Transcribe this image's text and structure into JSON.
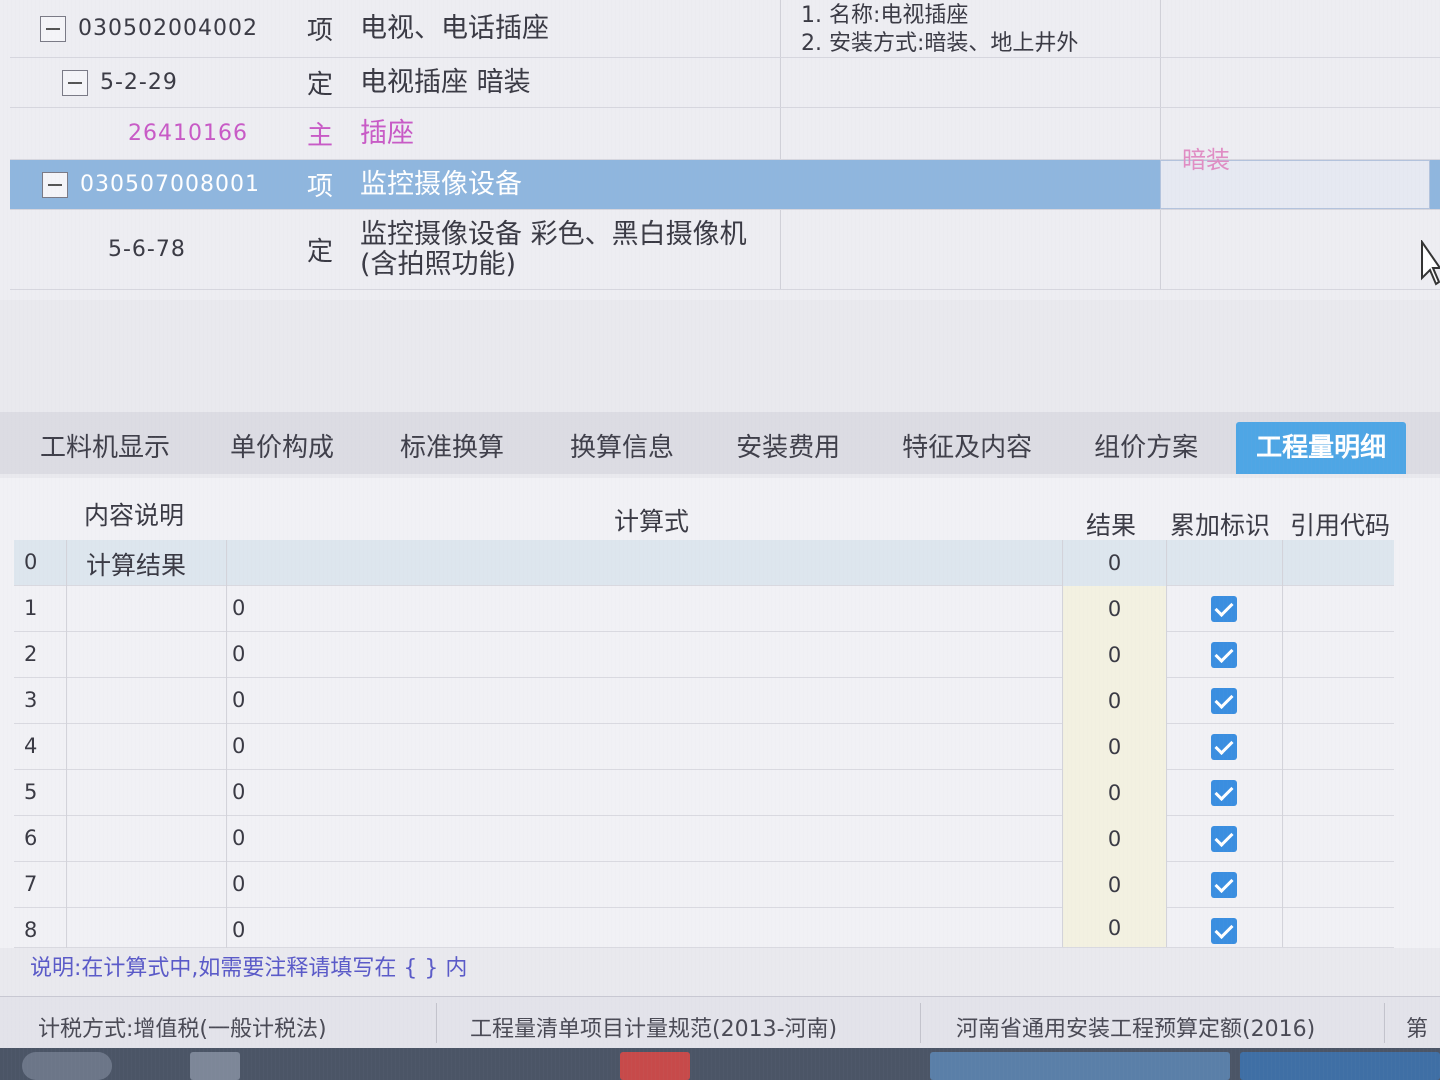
{
  "bill_rows": [
    {
      "code": "030502004002",
      "type": "项",
      "name": "电视、电话插座",
      "features": "1. 名称:电视插座\n2. 安装方式:暗装、地上井外"
    },
    {
      "code": "5-2-29",
      "type": "定",
      "name": "电视插座 暗装",
      "features": ""
    },
    {
      "code": "26410166",
      "type": "主",
      "name": "插座",
      "features": ""
    },
    {
      "code": "030507008001",
      "type": "项",
      "name": "监控摄像设备",
      "features": ""
    },
    {
      "code": "5-6-78",
      "type": "定",
      "name": "监控摄像设备 彩色、黑白摄像机(含拍照功能)",
      "features": ""
    }
  ],
  "side_tag": "暗装",
  "tabs": [
    {
      "label": "工料机显示"
    },
    {
      "label": "单价构成"
    },
    {
      "label": "标准换算"
    },
    {
      "label": "换算信息"
    },
    {
      "label": "安装费用"
    },
    {
      "label": "特征及内容"
    },
    {
      "label": "组价方案"
    },
    {
      "label": "工程量明细"
    }
  ],
  "grid": {
    "headers": {
      "desc": "内容说明",
      "formula": "计算式",
      "result": "结果",
      "accumulate": "累加标识",
      "ref_code": "引用代码"
    },
    "summary": {
      "index": "0",
      "desc": "计算结果",
      "result": "0"
    },
    "rows": [
      {
        "index": "1",
        "formula": "0",
        "result": "0",
        "checked": true
      },
      {
        "index": "2",
        "formula": "0",
        "result": "0",
        "checked": true
      },
      {
        "index": "3",
        "formula": "0",
        "result": "0",
        "checked": true
      },
      {
        "index": "4",
        "formula": "0",
        "result": "0",
        "checked": true
      },
      {
        "index": "5",
        "formula": "0",
        "result": "0",
        "checked": true
      },
      {
        "index": "6",
        "formula": "0",
        "result": "0",
        "checked": true
      },
      {
        "index": "7",
        "formula": "0",
        "result": "0",
        "checked": true
      },
      {
        "index": "8",
        "formula": "0",
        "result": "0",
        "checked": true
      }
    ]
  },
  "note": "说明:在计算式中,如需要注释请填写在 { } 内",
  "status": {
    "tax": "计税方式:增值税(一般计税法)",
    "spec": "工程量清单项目计量规范(2013-河南)",
    "quota": "河南省通用安装工程预算定额(2016)",
    "extra": "第"
  },
  "colors": {
    "selected_row": "#8fb6de",
    "active_tab": "#4ea6e5",
    "checkbox": "#3a8ee0",
    "main_material": "#c85ac6"
  }
}
